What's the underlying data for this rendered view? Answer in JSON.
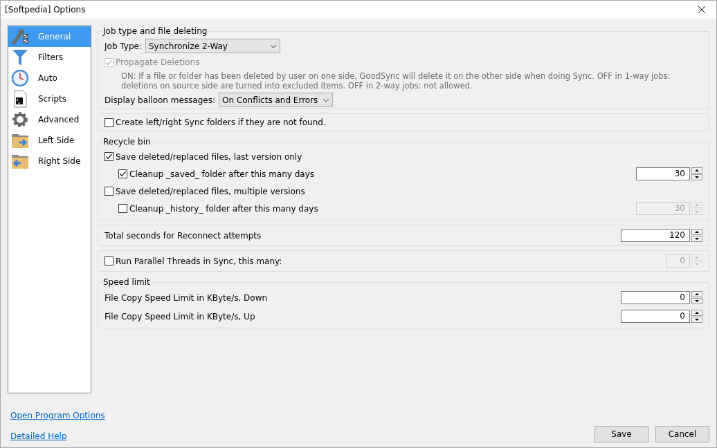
{
  "window": {
    "title": "[Softpedia] Options"
  },
  "sidebar": {
    "items": [
      {
        "label": "General",
        "kind": "general",
        "selected": true
      },
      {
        "label": "Filters",
        "kind": "filter",
        "selected": false
      },
      {
        "label": "Auto",
        "kind": "clock",
        "selected": false
      },
      {
        "label": "Scripts",
        "kind": "script",
        "selected": false
      },
      {
        "label": "Advanced",
        "kind": "gear",
        "selected": false
      },
      {
        "label": "Left Side",
        "kind": "folder-right",
        "selected": false
      },
      {
        "label": "Right Side",
        "kind": "folder-left",
        "selected": false
      }
    ]
  },
  "job_section": {
    "title": "Job type and file deleting",
    "job_type": {
      "label": "Job Type:",
      "value": "Synchronize 2-Way"
    },
    "propagate": {
      "label": "Propagate Deletions",
      "checked": true,
      "disabled": true
    },
    "description": "ON: If a file or folder has been deleted by user on one side, GoodSync will delete it on the other side when doing Sync.  OFF in 1-way jobs: deletions on source side are turned into excluded items. OFF in 2-way jobs: not allowed.",
    "balloon": {
      "label": "Display balloon messages:",
      "value": "On Conflicts and Errors"
    }
  },
  "create_folders": {
    "label": "Create left/right Sync folders if they are not found.",
    "checked": false
  },
  "recycle_bin": {
    "title": "Recycle bin",
    "items": [
      {
        "label": "Save deleted/replaced files, last version only",
        "checked": true,
        "children": [
          {
            "label": "Cleanup _saved_ folder after this many days",
            "checked": true,
            "value": "30",
            "disabled": false
          }
        ]
      },
      {
        "label": "Save deleted/replaced files, multiple versions",
        "checked": false,
        "children": [
          {
            "label": "Cleanup _history_ folder after this many days",
            "checked": false,
            "value": "30",
            "disabled": true
          }
        ]
      }
    ]
  },
  "reconnect": {
    "label": "Total seconds for Reconnect attempts",
    "value": "120"
  },
  "parallel": {
    "label": "Run Parallel Threads in Sync, this many:",
    "checked": false,
    "value": "0",
    "disabled": true
  },
  "speed_limit": {
    "title": "Speed limit",
    "rows": [
      {
        "label": "File Copy Speed Limit in KByte/s, Down",
        "value": "0"
      },
      {
        "label": "File Copy Speed Limit in KByte/s, Up",
        "value": "0"
      }
    ]
  },
  "links": [
    "Open Program Options",
    "Detailed Help"
  ],
  "buttons": [
    "Save",
    "Cancel"
  ]
}
